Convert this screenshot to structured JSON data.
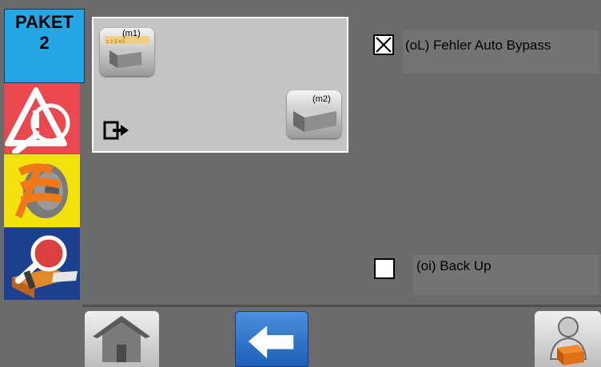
{
  "paket": {
    "line1": "PAKET",
    "line2": "2"
  },
  "panel": {
    "m1_label": "(m1)",
    "m2_label": "(m2)",
    "ruler_numbers": "1 2 3 4 5"
  },
  "options": [
    {
      "label": "(oL) Fehler Auto Bypass",
      "checked": true
    },
    {
      "label": "(oi) Back Up",
      "checked": false
    }
  ],
  "sidebar": {
    "icons": [
      "warning-magnifier-icon",
      "tape-roll-icon",
      "inspect-package-icon"
    ]
  },
  "nav": {
    "icons": [
      "home-icon",
      "back-arrow-icon",
      "operator-icon"
    ]
  },
  "colors": {
    "paket_bg": "#25a7e6",
    "warning_bg": "#e9484e",
    "tape_bg": "#f2e10b",
    "search_bg": "#1d3f8f",
    "back_btn": "#2a6fc9"
  }
}
